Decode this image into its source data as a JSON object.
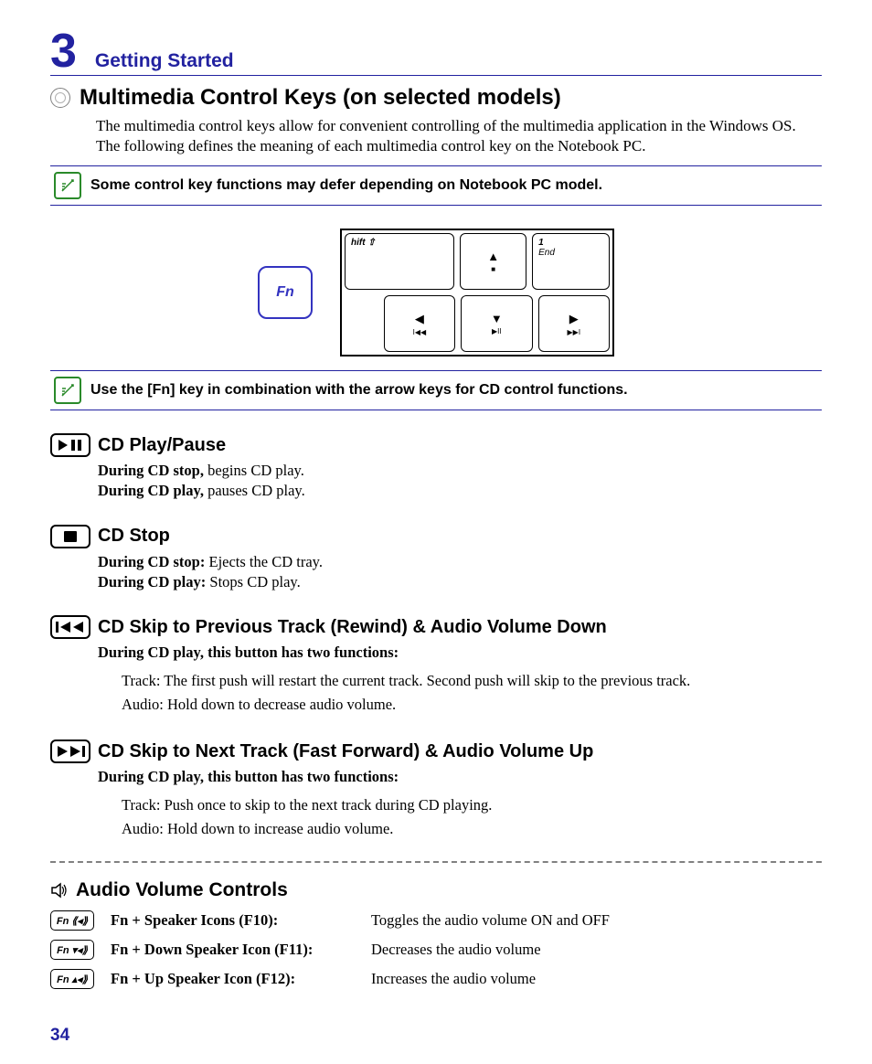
{
  "chapter": {
    "number": "3",
    "title": "Getting Started"
  },
  "h1": "Multimedia Control Keys (on selected models)",
  "intro": "The multimedia control keys allow for convenient controlling of the multimedia application in the Windows OS. The following defines the meaning of each multimedia control key on the Notebook PC.",
  "note1": "Some control key functions may defer depending on Notebook PC model.",
  "keyboard": {
    "fn_label": "Fn",
    "shift_label": "hift ⇧",
    "end_top": "1",
    "end_bottom": "End"
  },
  "note2": "Use the [Fn] key in combination with the arrow keys for CD control functions.",
  "sections": [
    {
      "icon": "play-pause",
      "title": "CD Play/Pause",
      "lines": [
        {
          "bold": "During CD stop,",
          "rest": " begins CD play."
        },
        {
          "bold": "During CD play,",
          "rest": " pauses CD play."
        }
      ]
    },
    {
      "icon": "stop",
      "title": "CD Stop",
      "lines": [
        {
          "bold": "During CD stop:",
          "rest": " Ejects the CD tray."
        },
        {
          "bold": "During CD play:",
          "rest": " Stops CD play."
        }
      ]
    },
    {
      "icon": "prev",
      "title": "CD Skip to Previous Track (Rewind) & Audio Volume Down",
      "intro_bold": "During CD play, this button has two functions:",
      "details": [
        {
          "bold": "Track:",
          "rest_pre": " The first push will restart the current track. Second push will skip to the ",
          "bold2": "previous",
          "rest_post": " track."
        },
        {
          "bold": "Audio:",
          "rest_pre": " Hold down to ",
          "bold2": "decrease",
          "rest_post": " audio volume."
        }
      ]
    },
    {
      "icon": "next",
      "title": "CD Skip to Next Track (Fast Forward) & Audio Volume Up",
      "intro_bold": "During CD play, this button has two functions:",
      "plain_details": [
        "Track: Push once to skip to the next track during CD playing.",
        "Audio: Hold down to increase audio volume."
      ]
    }
  ],
  "audio_controls": {
    "title": "Audio Volume Controls",
    "rows": [
      {
        "fn_glyph": "Fn ⟪◂⟫",
        "label": "Fn + Speaker Icons (F10):",
        "desc": "Toggles the audio volume ON and OFF"
      },
      {
        "fn_glyph": "Fn ▾◂⟫",
        "label": "Fn + Down Speaker Icon (F11):",
        "desc": "Decreases the audio volume"
      },
      {
        "fn_glyph": "Fn ▴◂⟫",
        "label": "Fn + Up Speaker Icon (F12):",
        "desc": "Increases the audio volume"
      }
    ]
  },
  "page_number": "34"
}
